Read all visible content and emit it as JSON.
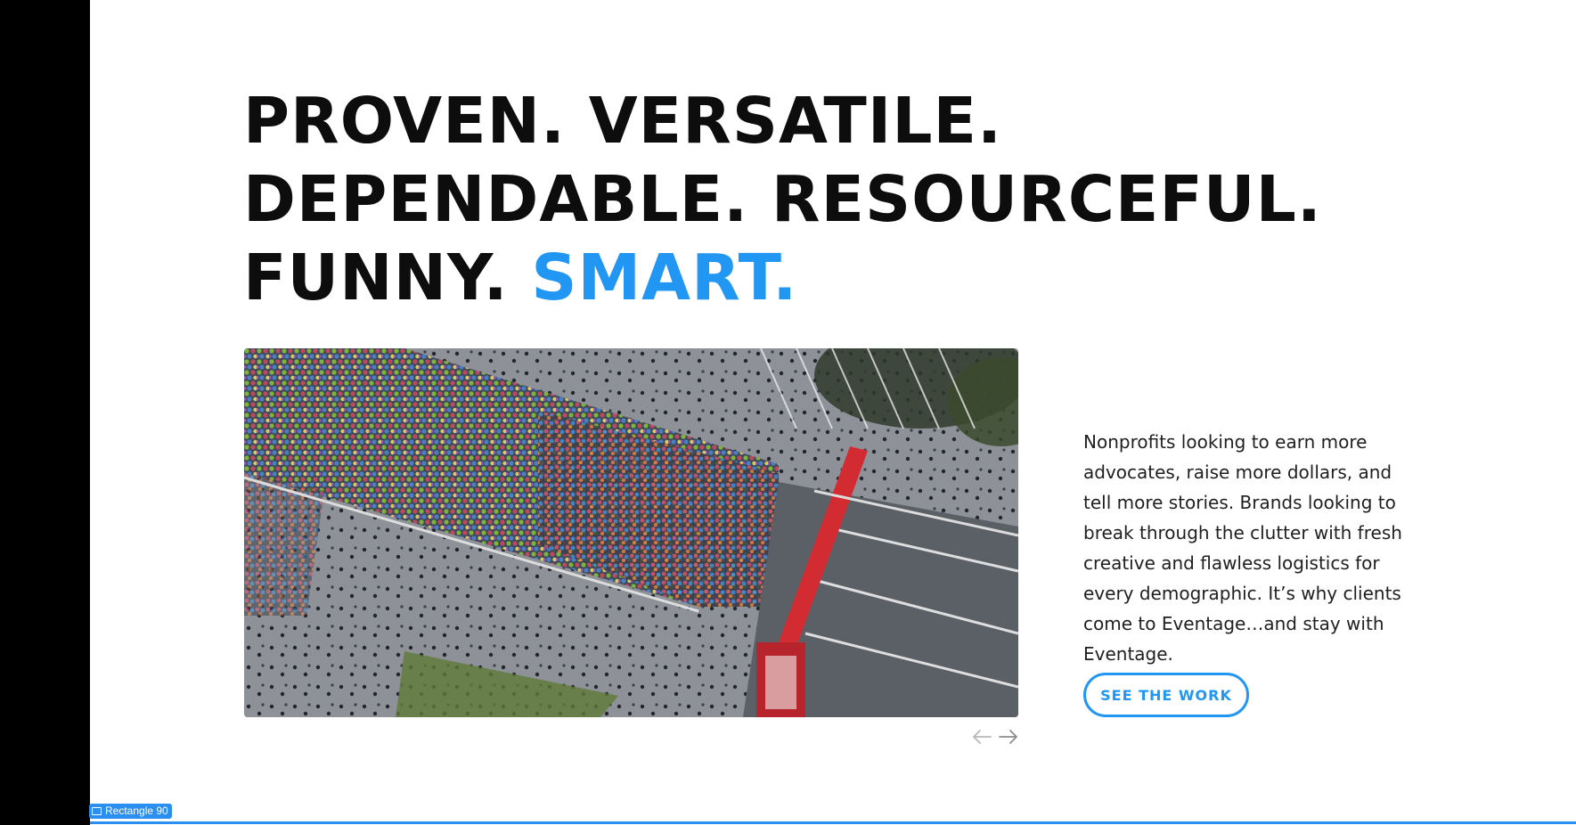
{
  "headline": {
    "line1": "PROVEN. VERSATILE.",
    "line2": "DEPENDABLE. RESOURCEFUL.",
    "line3_plain": "FUNNY.",
    "line3_accent": "SMART."
  },
  "body_copy": "Nonprofits looking to earn more advocates, raise more dollars, and tell more stories.  Brands looking to break through the clutter with fresh creative and flawless logistics for every demographic.  It’s why clients come to Eventage…and stay with Eventage.",
  "cta": {
    "label": "SEE THE WORK"
  },
  "slider": {
    "prev_icon": "arrow-left-icon",
    "next_icon": "arrow-right-icon"
  },
  "hero_image": {
    "alt": "aerial-crowd-race-start-photo"
  },
  "layer_tag": {
    "label": "Rectangle 90",
    "icon": "rectangle-icon"
  },
  "colors": {
    "accent": "#2196f3",
    "text": "#0d0d0d",
    "selection": "#2a8ff0",
    "left_bar": "#000000"
  }
}
